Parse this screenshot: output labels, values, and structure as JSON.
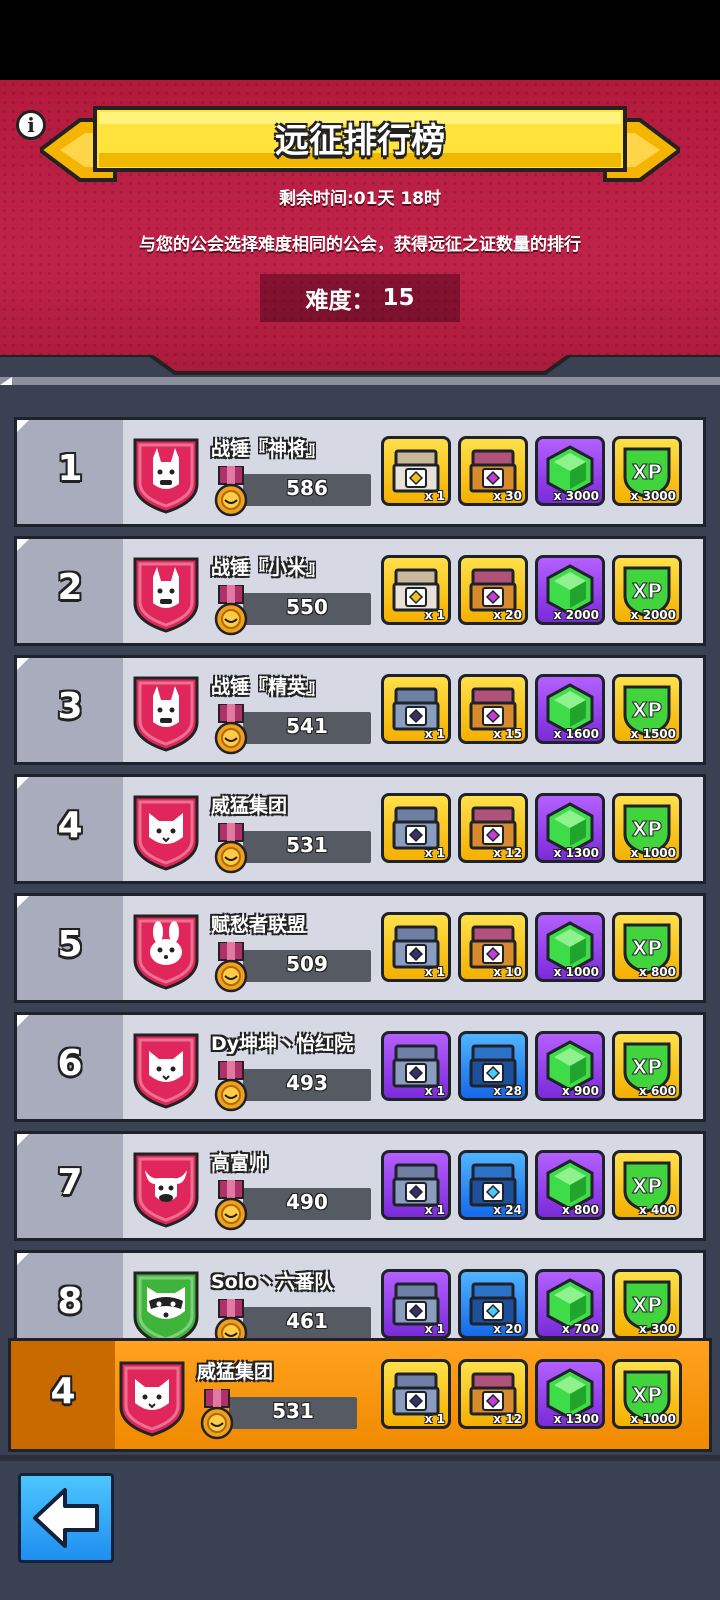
{
  "header": {
    "title": "远征排行榜",
    "remaining_label": "剩余时间:01天 18时",
    "description": "与您的公会选择难度相同的公会，获得远征之证数量的排行",
    "difficulty_label": "难度：",
    "difficulty_value": "15"
  },
  "rows": [
    {
      "rank": "1",
      "name": "战锤『神将』",
      "score": "586",
      "emblem": "llama-emblem",
      "emblem_color": "#e0265a",
      "rewards": [
        {
          "icon": "gold-chest-icon",
          "bg": "yellow",
          "qty": "x 1"
        },
        {
          "icon": "treasure-chest-icon",
          "bg": "yellow",
          "qty": "x 30"
        },
        {
          "icon": "gem-icon",
          "bg": "purple",
          "qty": "x 3000"
        },
        {
          "icon": "xp-icon",
          "bg": "yellow",
          "qty": "x 3000"
        }
      ]
    },
    {
      "rank": "2",
      "name": "战锤『小米』",
      "score": "550",
      "emblem": "llama-emblem",
      "emblem_color": "#e0265a",
      "rewards": [
        {
          "icon": "gold-chest-icon",
          "bg": "yellow",
          "qty": "x 1"
        },
        {
          "icon": "treasure-chest-icon",
          "bg": "yellow",
          "qty": "x 20"
        },
        {
          "icon": "gem-icon",
          "bg": "purple",
          "qty": "x 2000"
        },
        {
          "icon": "xp-icon",
          "bg": "yellow",
          "qty": "x 2000"
        }
      ]
    },
    {
      "rank": "3",
      "name": "战锤『精英』",
      "score": "541",
      "emblem": "llama-emblem",
      "emblem_color": "#e0265a",
      "rewards": [
        {
          "icon": "silver-chest-icon",
          "bg": "yellow",
          "qty": "x 1"
        },
        {
          "icon": "treasure-chest-icon",
          "bg": "yellow",
          "qty": "x 15"
        },
        {
          "icon": "gem-icon",
          "bg": "purple",
          "qty": "x 1600"
        },
        {
          "icon": "xp-icon",
          "bg": "yellow",
          "qty": "x 1500"
        }
      ]
    },
    {
      "rank": "4",
      "name": "威猛集团",
      "score": "531",
      "emblem": "cat-emblem",
      "emblem_color": "#e0265a",
      "rewards": [
        {
          "icon": "silver-chest-icon",
          "bg": "yellow",
          "qty": "x 1"
        },
        {
          "icon": "treasure-chest-icon",
          "bg": "yellow",
          "qty": "x 12"
        },
        {
          "icon": "gem-icon",
          "bg": "purple",
          "qty": "x 1300"
        },
        {
          "icon": "xp-icon",
          "bg": "yellow",
          "qty": "x 1000"
        }
      ]
    },
    {
      "rank": "5",
      "name": "赋愁者联盟",
      "score": "509",
      "emblem": "rabbit-emblem",
      "emblem_color": "#e0265a",
      "rewards": [
        {
          "icon": "silver-chest-icon",
          "bg": "yellow",
          "qty": "x 1"
        },
        {
          "icon": "treasure-chest-icon",
          "bg": "yellow",
          "qty": "x 10"
        },
        {
          "icon": "gem-icon",
          "bg": "purple",
          "qty": "x 1000"
        },
        {
          "icon": "xp-icon",
          "bg": "yellow",
          "qty": "x 800"
        }
      ]
    },
    {
      "rank": "6",
      "name": "Dy坤坤丶怡红院",
      "score": "493",
      "emblem": "cat-emblem",
      "emblem_color": "#e0265a",
      "rewards": [
        {
          "icon": "silver-chest-icon",
          "bg": "purple",
          "qty": "x 1"
        },
        {
          "icon": "blue-chest-icon",
          "bg": "blue",
          "qty": "x 28"
        },
        {
          "icon": "gem-icon",
          "bg": "purple",
          "qty": "x 900"
        },
        {
          "icon": "xp-icon",
          "bg": "yellow",
          "qty": "x 600"
        }
      ]
    },
    {
      "rank": "7",
      "name": "高富帅",
      "score": "490",
      "emblem": "bull-emblem",
      "emblem_color": "#e0265a",
      "rewards": [
        {
          "icon": "silver-chest-icon",
          "bg": "purple",
          "qty": "x 1"
        },
        {
          "icon": "blue-chest-icon",
          "bg": "blue",
          "qty": "x 24"
        },
        {
          "icon": "gem-icon",
          "bg": "purple",
          "qty": "x 800"
        },
        {
          "icon": "xp-icon",
          "bg": "yellow",
          "qty": "x 400"
        }
      ]
    },
    {
      "rank": "8",
      "name": "Solo丶六番队",
      "score": "461",
      "emblem": "raccoon-emblem",
      "emblem_color": "#3fb43a",
      "rewards": [
        {
          "icon": "silver-chest-icon",
          "bg": "purple",
          "qty": "x 1"
        },
        {
          "icon": "blue-chest-icon",
          "bg": "blue",
          "qty": "x 20"
        },
        {
          "icon": "gem-icon",
          "bg": "purple",
          "qty": "x 700"
        },
        {
          "icon": "xp-icon",
          "bg": "yellow",
          "qty": "x 300"
        }
      ]
    }
  ],
  "self_row": {
    "rank": "4",
    "name": "威猛集团",
    "score": "531",
    "emblem": "cat-emblem",
    "emblem_color": "#e0265a",
    "rewards": [
      {
        "icon": "silver-chest-icon",
        "bg": "yellow",
        "qty": "x 1"
      },
      {
        "icon": "treasure-chest-icon",
        "bg": "yellow",
        "qty": "x 12"
      },
      {
        "icon": "gem-icon",
        "bg": "purple",
        "qty": "x 1300"
      },
      {
        "icon": "xp-icon",
        "bg": "yellow",
        "qty": "x 1000"
      }
    ]
  },
  "footer": {
    "back_icon": "back-arrow-icon"
  }
}
